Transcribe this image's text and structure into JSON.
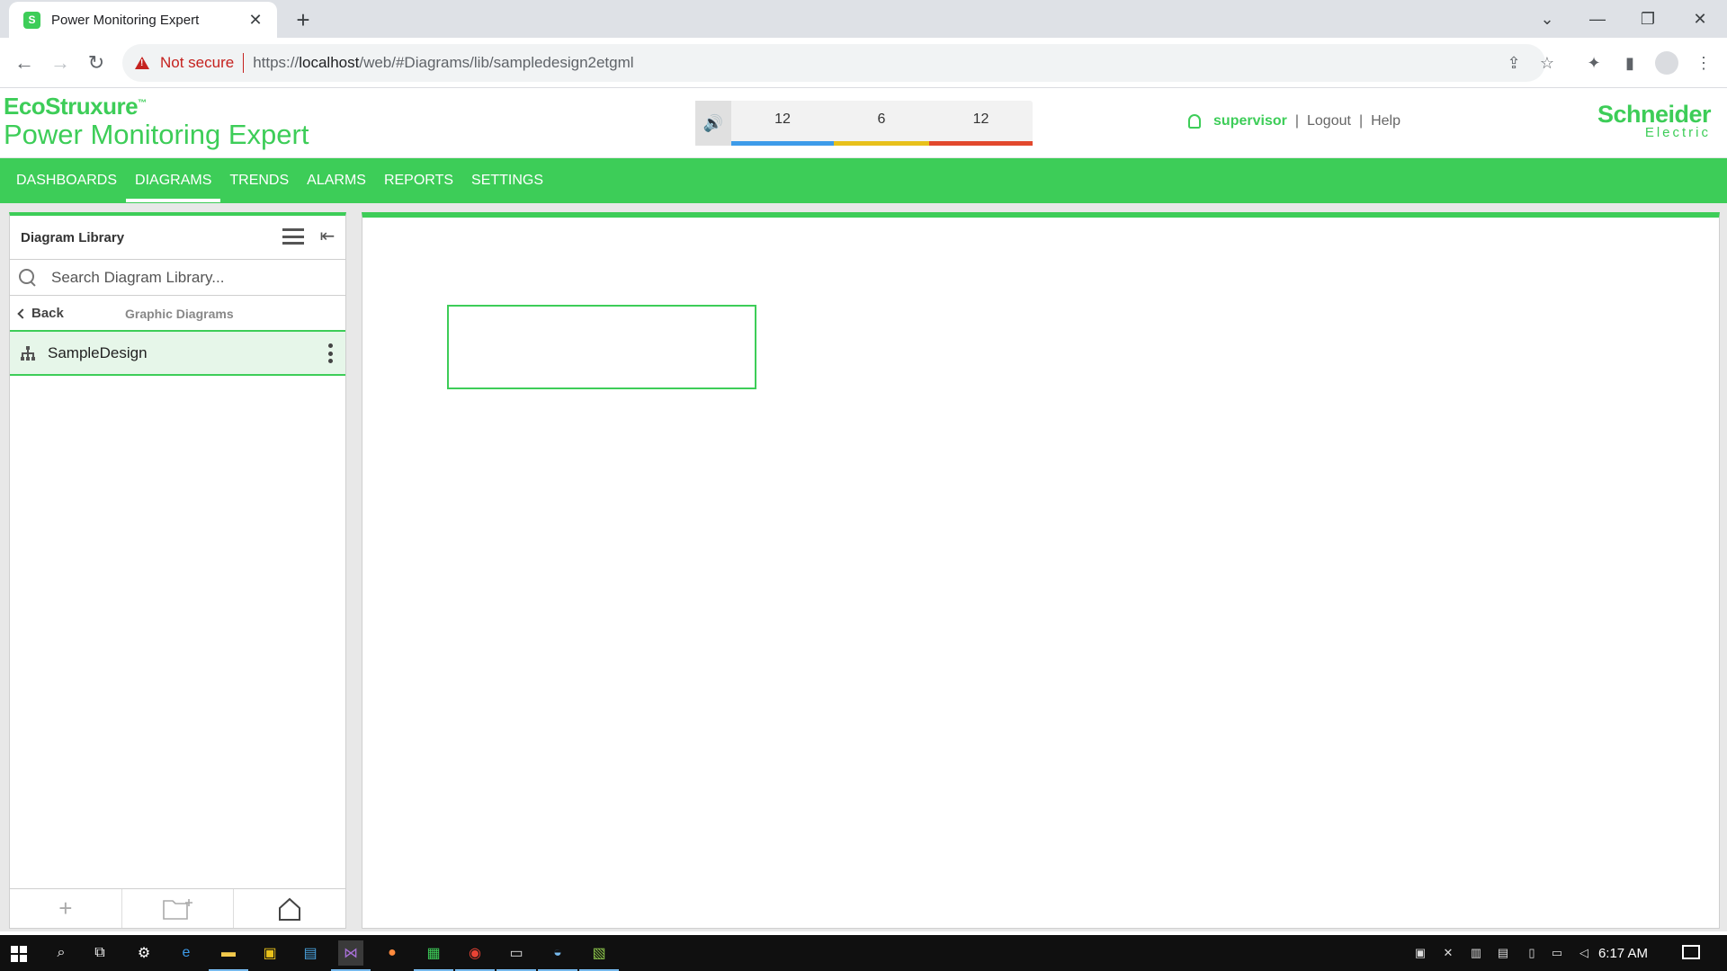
{
  "browser": {
    "tab_title": "Power Monitoring Expert",
    "tab_favicon": "S",
    "new_tab": "+",
    "close_tab": "✕",
    "security_label": "Not secure",
    "url_scheme": "https://",
    "url_host": "localhost",
    "url_path": "/web/#Diagrams/lib/sampledesign2etgml"
  },
  "app": {
    "brand_top": "EcoStruxure",
    "brand_tm": "™",
    "product_name": "Power Monitoring Expert",
    "vendor_line1": "Schneider",
    "vendor_line2": "Electric",
    "accent_color": "#3dcd58"
  },
  "alarms": {
    "low_count": "12",
    "medium_count": "6",
    "high_count": "12",
    "low_color": "#3d9be9",
    "medium_color": "#e8c11b",
    "high_color": "#e2482d"
  },
  "user": {
    "name": "supervisor",
    "sep1": "|",
    "logout": "Logout",
    "sep2": "|",
    "help": "Help"
  },
  "nav": {
    "items": [
      "DASHBOARDS",
      "DIAGRAMS",
      "TRENDS",
      "ALARMS",
      "REPORTS",
      "SETTINGS"
    ],
    "active": "DIAGRAMS"
  },
  "library": {
    "title": "Diagram Library",
    "search_placeholder": "Search Diagram Library...",
    "back_label": "Back",
    "crumb_title": "Graphic Diagrams",
    "items": [
      {
        "label": "SampleDesign",
        "icon": "diagram-hierarchy-icon"
      }
    ]
  },
  "taskbar": {
    "clock": "6:17 AM"
  }
}
